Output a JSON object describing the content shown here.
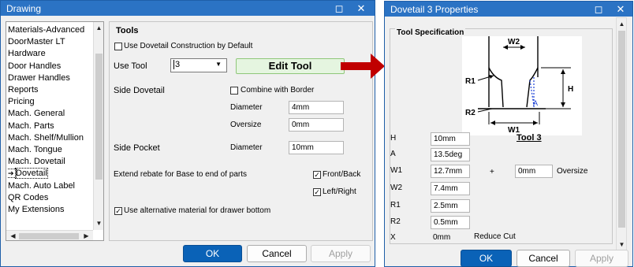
{
  "drawing_window": {
    "title": "Drawing",
    "tree_items": [
      "Materials-Advanced",
      "DoorMaster LT",
      "Hardware",
      "Door Handles",
      "Drawer Handles",
      "Reports",
      "Pricing",
      "Mach. General",
      "Mach. Parts",
      "Mach. Shelf/Mullion",
      "Mach. Tongue",
      "Mach. Dovetail",
      "Dovetail",
      "Mach. Auto Label",
      "QR Codes",
      "My Extensions"
    ],
    "selected_item_index": 12,
    "tools_group_title": "Tools",
    "use_dovetail_construction": {
      "label": "Use Dovetail Construction by Default",
      "checked": false
    },
    "use_tool_label": "Use Tool",
    "use_tool_value": "3",
    "edit_tool_label": "Edit Tool",
    "side_dovetail_label": "Side Dovetail",
    "combine_with_border": {
      "label": "Combine with Border",
      "checked": false
    },
    "diameter_label": "Diameter",
    "diameter_value": "4mm",
    "oversize_label": "Oversize",
    "oversize_value": "0mm",
    "side_pocket_label": "Side Pocket",
    "side_pocket_diameter_label": "Diameter",
    "side_pocket_diameter_value": "10mm",
    "extend_rebate_label": "Extend rebate for Base to end of parts",
    "front_back": {
      "label": "Front/Back",
      "checked": true
    },
    "left_right": {
      "label": "Left/Right",
      "checked": true
    },
    "alt_material": {
      "label": "Use alternative material for drawer bottom",
      "checked": true
    },
    "ok_label": "OK",
    "cancel_label": "Cancel",
    "apply_label": "Apply"
  },
  "properties_window": {
    "title": "Dovetail 3 Properties",
    "group_title": "Tool Specification",
    "tool_caption": "Tool 3",
    "diagram_labels": {
      "w2": "W2",
      "w1": "W1",
      "h": "H",
      "r1": "R1",
      "r2": "R2",
      "a": "A"
    },
    "fields": [
      {
        "label": "H",
        "value": "10mm"
      },
      {
        "label": "A",
        "value": "13.5deg"
      },
      {
        "label": "W1",
        "value": "12.7mm"
      },
      {
        "label": "W2",
        "value": "7.4mm"
      },
      {
        "label": "R1",
        "value": "2.5mm"
      },
      {
        "label": "R2",
        "value": "0.5mm"
      },
      {
        "label": "X",
        "value": "0mm"
      }
    ],
    "plus_sign": "+",
    "oversize_value": "0mm",
    "oversize_label": "Oversize",
    "reduce_cut_label": "Reduce Cut",
    "ok_label": "OK",
    "cancel_label": "Cancel",
    "apply_label": "Apply"
  },
  "colors": {
    "titlebar": "#2b73c4",
    "primary_button": "#0a62b7",
    "edit_tool_bg": "#e5f5e0",
    "arrow": "#c00000",
    "diagram_accent": "#1a3fd6"
  }
}
